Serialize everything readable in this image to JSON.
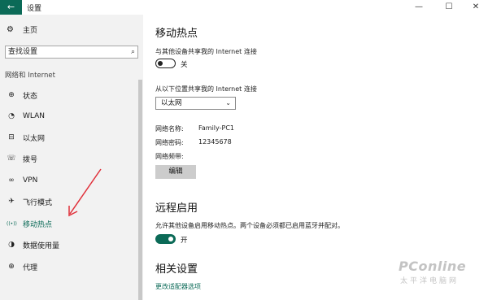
{
  "window": {
    "title": "设置",
    "back_icon": "←",
    "minimize_icon": "—",
    "maximize_icon": "☐",
    "close_icon": "✕"
  },
  "sidebar": {
    "home_label": "主页",
    "home_icon": "⚙",
    "search_placeholder": "查找设置",
    "search_icon": "⌕",
    "section_label": "网络和 Internet",
    "items": [
      {
        "label": "状态",
        "icon": "⊕"
      },
      {
        "label": "WLAN",
        "icon": "◔"
      },
      {
        "label": "以太网",
        "icon": "⊟"
      },
      {
        "label": "拨号",
        "icon": "☏"
      },
      {
        "label": "VPN",
        "icon": "∞"
      },
      {
        "label": "飞行模式",
        "icon": "✈"
      },
      {
        "label": "移动热点",
        "icon": "((•))",
        "active": true
      },
      {
        "label": "数据使用量",
        "icon": "◑"
      },
      {
        "label": "代理",
        "icon": "⊕"
      }
    ]
  },
  "main": {
    "title": "移动热点",
    "share_label": "与其他设备共享我的 Internet 连接",
    "share_toggle": {
      "state": "off",
      "label": "关"
    },
    "share_from_label": "从以下位置共享我的 Internet 连接",
    "share_from_value": "以太网",
    "chevron_icon": "⌄",
    "network_name_label": "网络名称:",
    "network_name_value": "Family-PC1",
    "network_password_label": "网络密码:",
    "network_password_value": "12345678",
    "network_band_label": "网络频带:",
    "edit_button": "编辑",
    "remote_title": "远程启用",
    "remote_desc": "允许其他设备启用移动热点。两个设备必须都已启用蓝牙并配对。",
    "remote_toggle": {
      "state": "on",
      "label": "开"
    },
    "related_title": "相关设置",
    "related_link": "更改适配器选项"
  },
  "watermark": {
    "logo": "PConline",
    "subtitle": "太平洋电脑网"
  },
  "colors": {
    "accent": "#0b6a57",
    "annotation": "#e0303a",
    "sidebar_bg": "#f2f2f2"
  }
}
